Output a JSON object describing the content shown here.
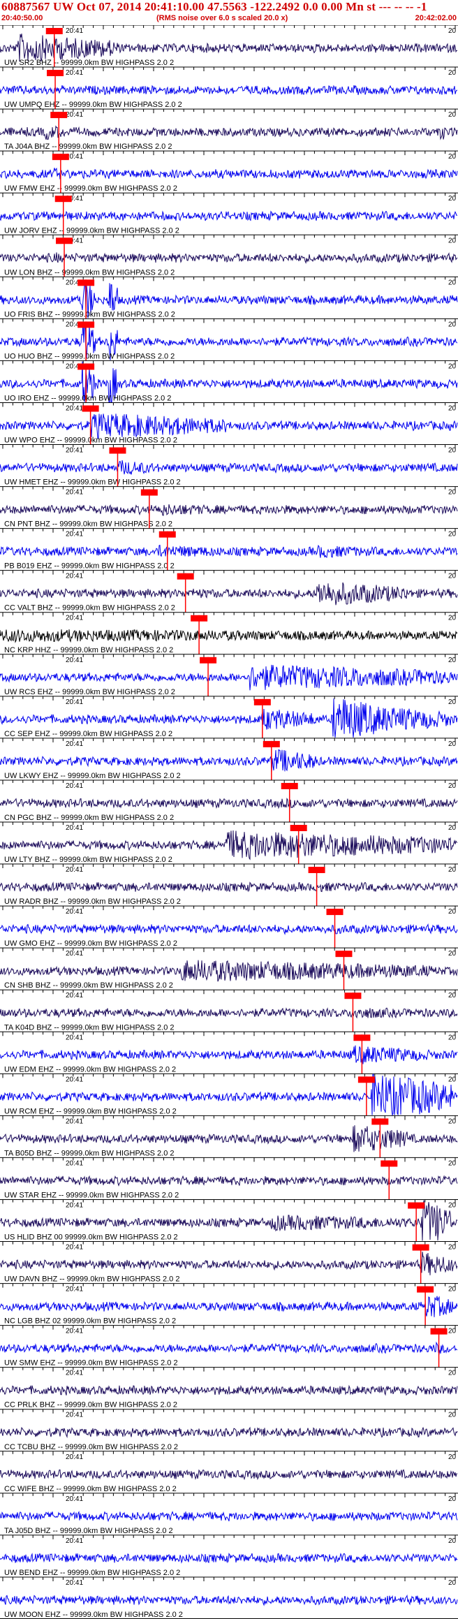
{
  "header": {
    "title": "60887567 UW Oct 07, 2014 20:41:10.00   47.5563 -122.2492  0.0 0.00 Mn st --- -- --  -1",
    "start_time": "20:40:50.00",
    "scale_note": "(RMS noise over 6.0 s scaled 20.0 x)",
    "end_time": "20:42:02.00"
  },
  "trace_time_label": "20:41",
  "trace_tick_label": "20",
  "colors": {
    "header_text": "#d00000",
    "trace_blue": "#0000ee",
    "trace_dark": "#1a0a5a",
    "trace_black": "#000000",
    "pick": "#ff0000",
    "axis": "#000000"
  },
  "channels": [
    {
      "label": "UW SR2 BHZ -- 99999.0km BW  HIGHPASS  2.0  2",
      "pick": 0.12,
      "color": "dark",
      "events": [
        [
          0.04,
          0.26,
          0.9
        ]
      ]
    },
    {
      "label": "UW UMPQ EHZ -- 99999.0km BW  HIGHPASS  2.0  2",
      "pick": 0.122,
      "color": "blue",
      "events": []
    },
    {
      "label": "TA J04A BHZ -- 99999.0km BW  HIGHPASS  2.0  2",
      "pick": 0.13,
      "color": "dark",
      "events": [
        [
          0.1,
          0.15,
          0.5
        ],
        [
          0.97,
          0.99,
          0.6
        ]
      ]
    },
    {
      "label": "UW FMW EHZ -- 99999.0km BW  HIGHPASS  2.0  2",
      "pick": 0.134,
      "color": "blue",
      "events": [
        [
          0.12,
          0.15,
          0.4
        ]
      ]
    },
    {
      "label": "UW JORV EHZ -- 99999.0km BW  HIGHPASS  2.0  2",
      "pick": 0.14,
      "color": "blue",
      "events": []
    },
    {
      "label": "UW LON BHZ -- 99999.0km BW  HIGHPASS  2.0  2",
      "pick": 0.142,
      "color": "dark",
      "events": [
        [
          0.12,
          0.14,
          0.4
        ]
      ]
    },
    {
      "label": "UO FRIS BHZ -- 99999.0km BW  HIGHPASS  2.0  2",
      "pick": 0.19,
      "color": "blue",
      "events": [
        [
          0.18,
          0.21,
          1.5
        ],
        [
          0.24,
          0.26,
          1.5
        ]
      ]
    },
    {
      "label": "UO HUO BHZ -- 99999.0km BW  HIGHPASS  2.0  2",
      "pick": 0.19,
      "color": "blue",
      "events": [
        [
          0.18,
          0.21,
          1.5
        ],
        [
          0.24,
          0.26,
          1.5
        ]
      ]
    },
    {
      "label": "UO IRO EHZ -- 99999.0km BW  HIGHPASS  2.0  2",
      "pick": 0.19,
      "color": "blue",
      "events": [
        [
          0.18,
          0.21,
          1.5
        ],
        [
          0.24,
          0.26,
          1.5
        ]
      ]
    },
    {
      "label": "UW WPO EHZ -- 99999.0km BW  HIGHPASS  2.0  2",
      "pick": 0.2,
      "color": "blue",
      "events": [
        [
          0.2,
          0.5,
          0.8
        ]
      ]
    },
    {
      "label": "UW HMET EHZ -- 99999.0km BW  HIGHPASS  2.0  2",
      "pick": 0.26,
      "color": "blue",
      "events": [
        [
          0.26,
          0.35,
          0.5
        ]
      ]
    },
    {
      "label": "CN PNT BHZ -- 99999.0km BW  HIGHPASS  2.0  2",
      "pick": 0.33,
      "color": "dark",
      "events": [
        [
          0.35,
          0.5,
          0.4
        ],
        [
          0.6,
          0.7,
          0.3
        ]
      ]
    },
    {
      "label": "PB B019 EHZ -- 99999.0km BW  HIGHPASS  2.0  2",
      "pick": 0.37,
      "color": "blue",
      "events": [
        [
          0.35,
          0.55,
          0.4
        ],
        [
          0.7,
          0.85,
          0.4
        ]
      ]
    },
    {
      "label": "CC VALT BHZ -- 99999.0km BW  HIGHPASS  2.0  2",
      "pick": 0.41,
      "color": "dark",
      "events": [
        [
          0.42,
          0.6,
          0.3
        ],
        [
          0.7,
          0.9,
          0.8
        ]
      ]
    },
    {
      "label": "NC KRP HHZ -- 99999.0km BW  HIGHPASS  2.0  2",
      "pick": 0.44,
      "color": "black",
      "events": [
        [
          0.0,
          1.0,
          0.4
        ]
      ]
    },
    {
      "label": "UW RCS EHZ -- 99999.0km BW  HIGHPASS  2.0  2",
      "pick": 0.46,
      "color": "blue",
      "events": [
        [
          0.55,
          1.0,
          0.8
        ]
      ]
    },
    {
      "label": "CC SEP EHZ -- 99999.0km BW  HIGHPASS  2.0  2",
      "pick": 0.58,
      "color": "blue",
      "events": [
        [
          0.58,
          0.7,
          0.7
        ],
        [
          0.735,
          0.85,
          1.5
        ],
        [
          0.85,
          1.0,
          0.8
        ]
      ]
    },
    {
      "label": "UW LKWY EHZ -- 99999.0km BW  HIGHPASS  2.0  2",
      "pick": 0.6,
      "color": "blue",
      "events": [
        [
          0.6,
          0.7,
          0.8
        ]
      ]
    },
    {
      "label": "CN PGC BHZ -- 99999.0km BW  HIGHPASS  2.0  2",
      "pick": 0.64,
      "color": "dark",
      "events": [
        [
          0.62,
          0.75,
          0.3
        ]
      ]
    },
    {
      "label": "UW LTY BHZ -- 99999.0km BW  HIGHPASS  2.0  2",
      "pick": 0.66,
      "color": "dark",
      "events": [
        [
          0.5,
          1.0,
          0.9
        ]
      ]
    },
    {
      "label": "UW RADR BHZ -- 99999.0km BW  HIGHPASS  2.0  2",
      "pick": 0.7,
      "color": "dark",
      "events": [
        [
          0.7,
          0.8,
          0.3
        ]
      ]
    },
    {
      "label": "UW GMO EHZ -- 99999.0km BW  HIGHPASS  2.0  2",
      "pick": 0.74,
      "color": "blue",
      "events": [
        [
          0.74,
          0.85,
          0.3
        ]
      ]
    },
    {
      "label": "CN SHB BHZ -- 99999.0km BW  HIGHPASS  2.0  2",
      "pick": 0.76,
      "color": "dark",
      "events": [
        [
          0.4,
          0.95,
          0.7
        ]
      ]
    },
    {
      "label": "TA K04D BHZ -- 99999.0km BW  HIGHPASS  2.0  2",
      "pick": 0.78,
      "color": "dark",
      "events": [
        [
          0.78,
          0.9,
          0.4
        ]
      ]
    },
    {
      "label": "UW EDM EHZ -- 99999.0km BW  HIGHPASS  2.0  2",
      "pick": 0.8,
      "color": "blue",
      "events": [
        [
          0.78,
          0.95,
          0.6
        ]
      ]
    },
    {
      "label": "UW RCM EHZ -- 99999.0km BW  HIGHPASS  2.0  2",
      "pick": 0.81,
      "color": "blue",
      "events": [
        [
          0.82,
          1.0,
          1.5
        ]
      ]
    },
    {
      "label": "TA B05D BHZ -- 99999.0km BW  HIGHPASS  2.0  2",
      "pick": 0.84,
      "color": "dark",
      "events": [
        [
          0.78,
          0.9,
          0.9
        ]
      ]
    },
    {
      "label": "UW STAR EHZ -- 99999.0km BW  HIGHPASS  2.0  2",
      "pick": 0.86,
      "color": "dark",
      "events": []
    },
    {
      "label": "US HLID BHZ 00 99999.0km BW  HIGHPASS  2.0  2",
      "pick": 0.92,
      "color": "dark",
      "events": [
        [
          0.6,
          0.93,
          0.5
        ],
        [
          0.93,
          1.0,
          1.5
        ]
      ]
    },
    {
      "label": "UW DAVN BHZ -- 99999.0km BW  HIGHPASS  2.0  2",
      "pick": 0.93,
      "color": "dark",
      "events": [
        [
          0.93,
          1.0,
          0.8
        ]
      ]
    },
    {
      "label": "NC LGB BHZ 02 99999.0km BW  HIGHPASS  2.0  2",
      "pick": 0.94,
      "color": "blue",
      "events": [
        [
          0.94,
          1.0,
          0.8
        ]
      ]
    },
    {
      "label": "UW SMW EHZ -- 99999.0km BW  HIGHPASS  2.0  2",
      "pick": 0.97,
      "color": "blue",
      "events": [
        [
          0.96,
          1.0,
          0.4
        ]
      ]
    },
    {
      "label": "CC PRLK BHZ -- 99999.0km BW  HIGHPASS  2.0  2",
      "pick": null,
      "color": "dark",
      "events": []
    },
    {
      "label": "CC TCBU BHZ -- 99999.0km BW  HIGHPASS  2.0  2",
      "pick": null,
      "color": "dark",
      "events": []
    },
    {
      "label": "CC WIFE BHZ -- 99999.0km BW  HIGHPASS  2.0  2",
      "pick": null,
      "color": "dark",
      "events": []
    },
    {
      "label": "TA J05D BHZ -- 99999.0km BW  HIGHPASS  2.0  2",
      "pick": null,
      "color": "blue",
      "events": []
    },
    {
      "label": "UW BEND EHZ -- 99999.0km BW  HIGHPASS  2.0  2",
      "pick": null,
      "color": "blue",
      "events": []
    },
    {
      "label": "UW MOON EHZ -- 99999.0km BW  HIGHPASS  2.0  2",
      "pick": null,
      "color": "blue",
      "events": []
    }
  ]
}
